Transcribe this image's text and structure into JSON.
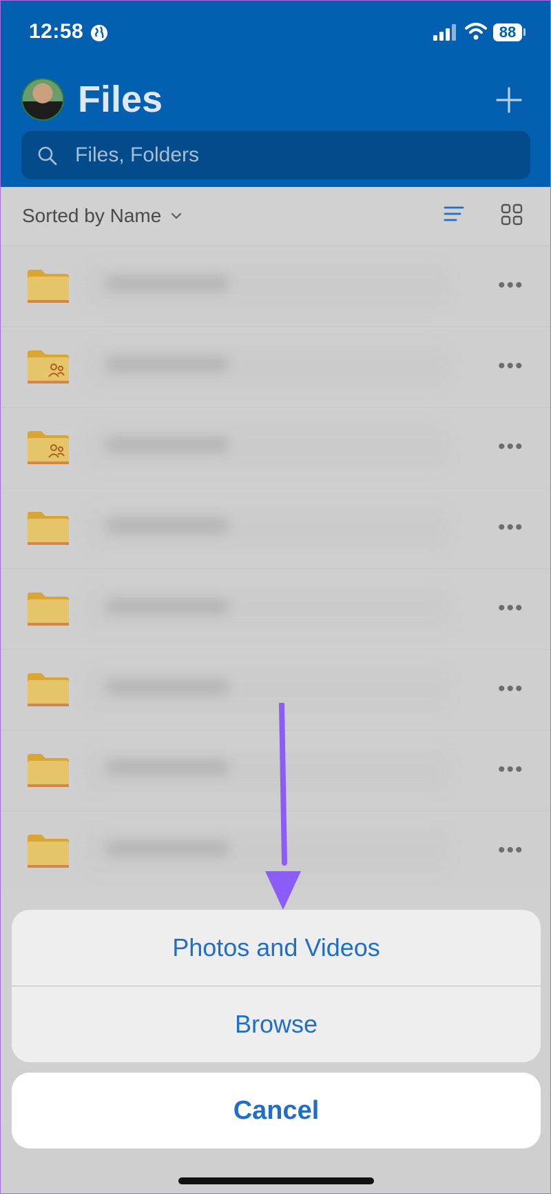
{
  "status_bar": {
    "time": "12:58",
    "battery": "88"
  },
  "header": {
    "title": "Files",
    "search_placeholder": "Files, Folders"
  },
  "toolbar": {
    "sort_label": "Sorted by Name"
  },
  "files": [
    {
      "icon": "folder-icon"
    },
    {
      "icon": "shared-folder-icon"
    },
    {
      "icon": "shared-folder-icon"
    },
    {
      "icon": "folder-icon"
    },
    {
      "icon": "folder-icon"
    },
    {
      "icon": "folder-icon"
    },
    {
      "icon": "folder-icon"
    },
    {
      "icon": "folder-icon"
    }
  ],
  "action_sheet": {
    "photos_label": "Photos and Videos",
    "browse_label": "Browse",
    "cancel_label": "Cancel"
  },
  "colors": {
    "header_bg": "#0360b0",
    "accent": "#1f6fc8",
    "folder": "#e6c46a",
    "annotation_arrow": "#8b5cf6"
  }
}
